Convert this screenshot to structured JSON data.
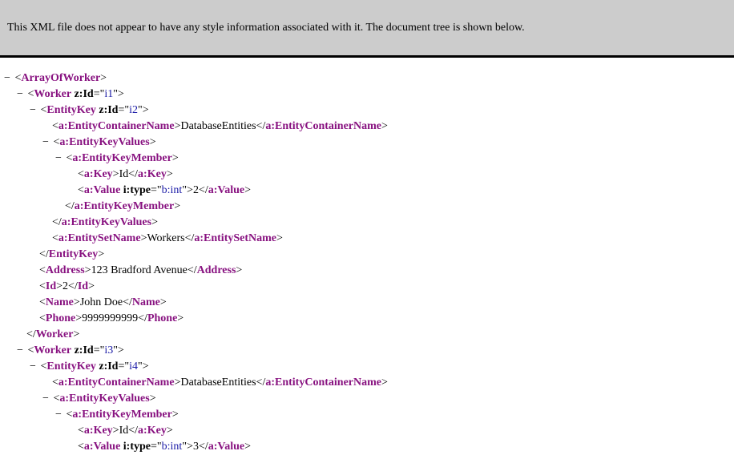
{
  "header": {
    "info": "This XML file does not appear to have any style information associated with it. The document tree is shown below."
  },
  "fold_symbol": "−",
  "colors": {
    "tag": "#881280",
    "attr_value": "#1a1aa6",
    "header_bg": "#cccccc"
  },
  "lines": [
    {
      "depth": 0,
      "fold": true,
      "kind": "open",
      "tag": "ArrayOfWorker",
      "attrs": []
    },
    {
      "depth": 1,
      "fold": true,
      "kind": "open",
      "tag": "Worker",
      "attrs": [
        {
          "n": "z:Id",
          "v": "i1"
        }
      ]
    },
    {
      "depth": 2,
      "fold": true,
      "kind": "open",
      "tag": "EntityKey",
      "attrs": [
        {
          "n": "z:Id",
          "v": "i2"
        }
      ]
    },
    {
      "depth": 3,
      "fold": false,
      "kind": "leaf",
      "tag": "a:EntityContainerName",
      "attrs": [],
      "text": "DatabaseEntities"
    },
    {
      "depth": 3,
      "fold": true,
      "kind": "open",
      "tag": "a:EntityKeyValues",
      "attrs": []
    },
    {
      "depth": 4,
      "fold": true,
      "kind": "open",
      "tag": "a:EntityKeyMember",
      "attrs": []
    },
    {
      "depth": 5,
      "fold": false,
      "kind": "leaf",
      "tag": "a:Key",
      "attrs": [],
      "text": "Id"
    },
    {
      "depth": 5,
      "fold": false,
      "kind": "leaf",
      "tag": "a:Value",
      "attrs": [
        {
          "n": "i:type",
          "v": "b:int"
        }
      ],
      "text": "2"
    },
    {
      "depth": 4,
      "fold": false,
      "kind": "close",
      "tag": "a:EntityKeyMember"
    },
    {
      "depth": 3,
      "fold": false,
      "kind": "close",
      "tag": "a:EntityKeyValues"
    },
    {
      "depth": 3,
      "fold": false,
      "kind": "leaf",
      "tag": "a:EntitySetName",
      "attrs": [],
      "text": "Workers"
    },
    {
      "depth": 2,
      "fold": false,
      "kind": "close",
      "tag": "EntityKey"
    },
    {
      "depth": 2,
      "fold": false,
      "kind": "leaf",
      "tag": "Address",
      "attrs": [],
      "text": "123 Bradford Avenue"
    },
    {
      "depth": 2,
      "fold": false,
      "kind": "leaf",
      "tag": "Id",
      "attrs": [],
      "text": "2"
    },
    {
      "depth": 2,
      "fold": false,
      "kind": "leaf",
      "tag": "Name",
      "attrs": [],
      "text": "John Doe"
    },
    {
      "depth": 2,
      "fold": false,
      "kind": "leaf",
      "tag": "Phone",
      "attrs": [],
      "text": "9999999999"
    },
    {
      "depth": 1,
      "fold": false,
      "kind": "close",
      "tag": "Worker"
    },
    {
      "depth": 1,
      "fold": true,
      "kind": "open",
      "tag": "Worker",
      "attrs": [
        {
          "n": "z:Id",
          "v": "i3"
        }
      ]
    },
    {
      "depth": 2,
      "fold": true,
      "kind": "open",
      "tag": "EntityKey",
      "attrs": [
        {
          "n": "z:Id",
          "v": "i4"
        }
      ]
    },
    {
      "depth": 3,
      "fold": false,
      "kind": "leaf",
      "tag": "a:EntityContainerName",
      "attrs": [],
      "text": "DatabaseEntities"
    },
    {
      "depth": 3,
      "fold": true,
      "kind": "open",
      "tag": "a:EntityKeyValues",
      "attrs": []
    },
    {
      "depth": 4,
      "fold": true,
      "kind": "open",
      "tag": "a:EntityKeyMember",
      "attrs": []
    },
    {
      "depth": 5,
      "fold": false,
      "kind": "leaf",
      "tag": "a:Key",
      "attrs": [],
      "text": "Id"
    },
    {
      "depth": 5,
      "fold": false,
      "kind": "leaf",
      "tag": "a:Value",
      "attrs": [
        {
          "n": "i:type",
          "v": "b:int"
        }
      ],
      "text": "3"
    }
  ]
}
